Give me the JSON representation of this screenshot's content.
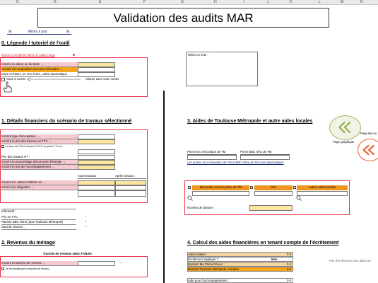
{
  "columns": [
    "C",
    "D",
    "E",
    "F",
    "G",
    "H",
    "I",
    "J",
    "K",
    "L",
    "M",
    "N"
  ],
  "title": "Validation des audits MAR",
  "menu": {
    "icon_left": "⊞",
    "label": "Mises à jour",
    "icon_right": "⊞"
  },
  "section0": {
    "heading": "0. Légende / tutoriel de l'outil",
    "note": "Zones à compléter dans un cadre rouge",
    "rows": [
      "Inscrire la valeur ou du texte →",
      "Choisir une proposition du menu déroulant →",
      "Case en blanc, ne rien écrire, calcul automatique"
    ],
    "checkbox_label": "Case à cocher",
    "arrow_label": "Cliquer avec votre souris"
  },
  "memo_label": "Mémo et note :",
  "section1": {
    "heading": "1. Détails financiers du scénario de travaux sélectionné",
    "rows": [
      "Inscrire type d'occupation →",
      "Inscrire le prix des travaux en TTC →",
      "Le taux de TVA n'est pas à 5.5 % ou pas à 7 % ou ...",
      "Prix des travaux HT :",
      "Inscrire le pourcentage d'économie d'énergie →",
      "Inscrire le prix de l'accompagnement →"
    ],
    "col_avant": "Avant travaux :",
    "col_apres": "Après travaux :",
    "rows2": [
      "Inscrire les valeurs kWh/m².an →",
      "Inscrire les étiquettes →"
    ],
    "info_rows": [
      "Informatif :",
      "Prix en TTC :",
      "Atteinte BBC Réno (pour Toulouse Métropole)",
      "Saut de classes :"
    ],
    "dash": "--"
  },
  "section2": {
    "heading": "2. Revenus du ménage",
    "table_header": "Tranche de revenus selon l'ANAH :",
    "rows": [
      "Inscrire la tranche de revenus →",
      "Je reconnais que la tranche de revenu..."
    ]
  },
  "section3": {
    "heading": "3. Aides de Toulouse Métropole et autre aides locales",
    "prime_left": "Prime Eco rénovation de TM",
    "prime_right": "Prime BBC réno de TM",
    "italic_note": "Les primes Eco rénovation de TM et BBC Réno de TM sont automatiques",
    "bonus_headers": [
      "Bonus Bio-sourcé prime de TM",
      "PIG",
      "Autres aides locales"
    ],
    "dossier_label": "Numéro de dossier :"
  },
  "graphics": {
    "caption1": "Page graphique",
    "caption2": "Page Bio-so"
  },
  "section4": {
    "heading": "4. Calcul des aides financières en tenant compte de l'écrêtement",
    "rows": [
      {
        "label": "Aides totales :",
        "value": "0 €"
      },
      {
        "label": "Écrêtement appliqué ?",
        "value": "Non"
      },
      {
        "label": "Montant Ma Prime Rénov' :",
        "value": "0 €"
      },
      {
        "label": "Montant Toulouse Métropole et autres",
        "value": "0 €"
      }
    ],
    "accomp_label": "Aide pour l'accompagnement :",
    "accomp_value": "0 €",
    "side_note": "Pas d'écrêtement des aides de"
  },
  "colors": {
    "red_frame": "#e8334a",
    "pink": "#f6c8cf",
    "orange": "#f5a51b",
    "gray": "#8d8d8d"
  }
}
